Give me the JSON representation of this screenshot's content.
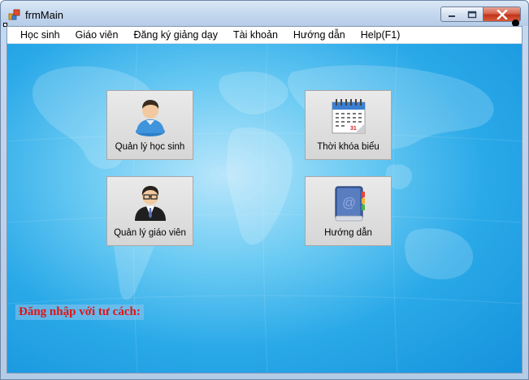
{
  "window": {
    "title": "frmMain",
    "app_icon": "app-icon",
    "controls": [
      "minimize-icon",
      "maximize-icon",
      "close-icon"
    ]
  },
  "menu": {
    "items": [
      {
        "label": "Học sinh"
      },
      {
        "label": "Giáo viên"
      },
      {
        "label": "Đăng ký giảng dạy"
      },
      {
        "label": "Tài khoản"
      },
      {
        "label": "Hướng dẫn"
      },
      {
        "label": "Help(F1)"
      }
    ]
  },
  "tiles": [
    {
      "label": "Quản lý học sinh",
      "icon": "student-user-icon"
    },
    {
      "label": "Thời khóa biểu",
      "icon": "calendar-icon"
    },
    {
      "label": "Quản lý giáo viên",
      "icon": "teacher-user-icon"
    },
    {
      "label": "Hướng dẫn",
      "icon": "address-book-icon"
    }
  ],
  "calendar_day": "31",
  "status": {
    "login_label": "Đăng nhập với tư cách:"
  },
  "colors": {
    "background_blue": "#2aa9e8",
    "login_label_red": "#e31313",
    "close_button_red": "#c2341b"
  }
}
